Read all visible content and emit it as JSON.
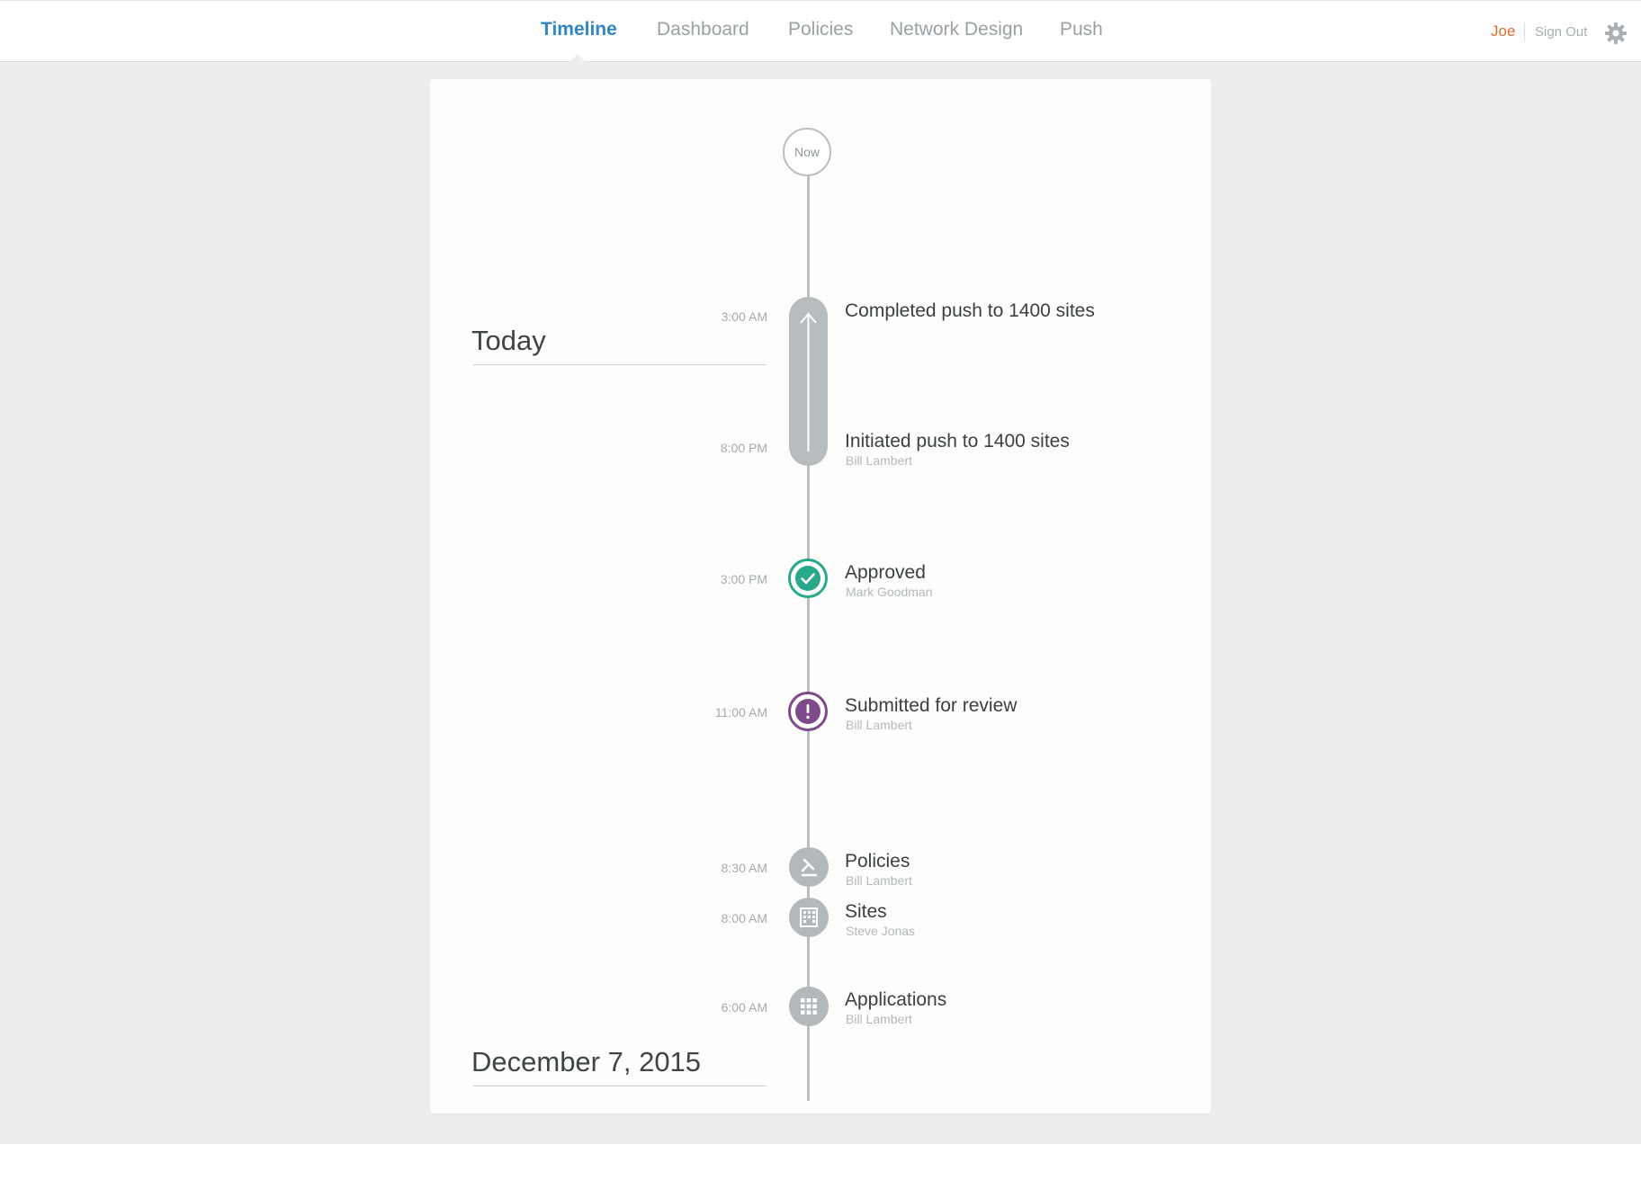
{
  "nav": {
    "items": [
      {
        "label": "Timeline",
        "active": true
      },
      {
        "label": "Dashboard",
        "active": false
      },
      {
        "label": "Policies",
        "active": false
      },
      {
        "label": "Network Design",
        "active": false
      },
      {
        "label": "Push",
        "active": false
      }
    ]
  },
  "user": {
    "name": "Joe",
    "sign_out": "Sign Out"
  },
  "timeline": {
    "now_label": "Now",
    "sections": [
      {
        "heading": "Today"
      },
      {
        "heading": "December 7, 2015"
      }
    ],
    "events": [
      {
        "time": "3:00 AM",
        "title": "Completed push to 1400 sites",
        "subtitle": "",
        "icon": "arrow-up-icon"
      },
      {
        "time": "8:00 PM",
        "title": "Initiated push to 1400 sites",
        "subtitle": "Bill Lambert",
        "icon": "arrow-up-icon"
      },
      {
        "time": "3:00 PM",
        "title": "Approved",
        "subtitle": "Mark Goodman",
        "icon": "check-icon"
      },
      {
        "time": "11:00 AM",
        "title": "Submitted for review",
        "subtitle": "Bill Lambert",
        "icon": "exclamation-icon"
      },
      {
        "time": "8:30 AM",
        "title": "Policies",
        "subtitle": "Bill Lambert",
        "icon": "gavel-icon"
      },
      {
        "time": "8:00 AM",
        "title": "Sites",
        "subtitle": "Steve Jonas",
        "icon": "building-icon"
      },
      {
        "time": "6:00 AM",
        "title": "Applications",
        "subtitle": "Bill Lambert",
        "icon": "grid-icon"
      }
    ]
  },
  "colors": {
    "accent_blue": "#2f86c3",
    "user_orange": "#e06a2c",
    "approved_green": "#2aa88a",
    "review_purple": "#7f4a8b",
    "marker_gray": "#b3b8ba"
  }
}
